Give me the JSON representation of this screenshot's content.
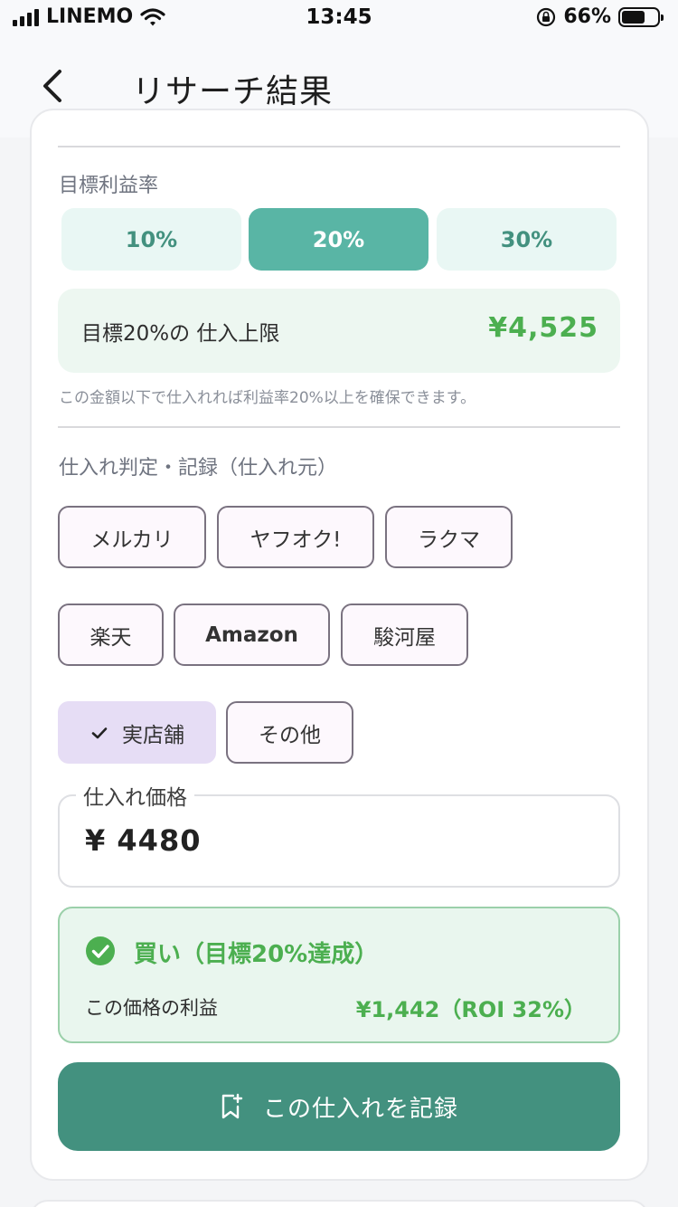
{
  "status": {
    "carrier": "LINEMO",
    "time": "13:45",
    "battery": "66%",
    "battery_level": 0.66
  },
  "nav": {
    "title": "リサーチ結果"
  },
  "target": {
    "label": "目標利益率",
    "options": [
      "10%",
      "20%",
      "30%"
    ],
    "selected": "20%",
    "limit_label": "目標20%の 仕入上限",
    "limit_value": "¥4,525",
    "note": "この金額以下で仕入れれば利益率20%以上を確保できます。"
  },
  "source": {
    "label": "仕入れ判定・記録（仕入れ元）",
    "chips": [
      "メルカリ",
      "ヤフオク!",
      "ラクマ",
      "楽天",
      "Amazon",
      "駿河屋",
      "実店舗",
      "その他"
    ],
    "selected": "実店舗"
  },
  "price": {
    "legend": "仕入れ価格",
    "value": "¥ 4480"
  },
  "result": {
    "title": "買い（目標20%達成）",
    "profit_label": "この価格の利益",
    "profit_value": "¥1,442（ROI 32%）"
  },
  "actions": {
    "record_label": "この仕入れを記録"
  },
  "colors": {
    "accent": "#43917f",
    "selected_segment": "#59b5a5",
    "success": "#4caf50",
    "chip_selected": "#e6ddf5"
  }
}
